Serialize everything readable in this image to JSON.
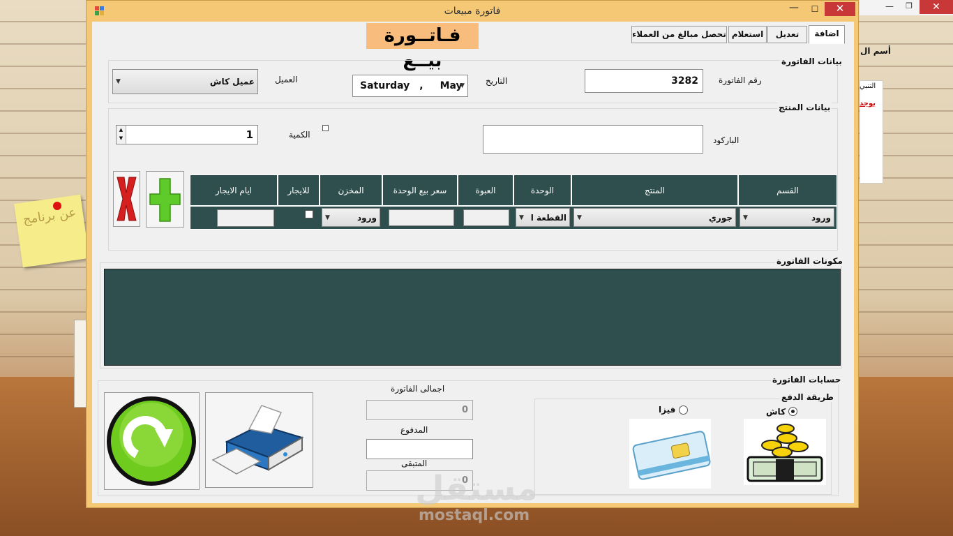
{
  "window": {
    "title": "فاتورة مبيعات",
    "minimize": "—",
    "maximize": "☐",
    "close": "✕"
  },
  "background": {
    "label": "أسم ال",
    "tanbih": "التنبي",
    "yujad": "يوجد",
    "sticky_note": "عن برنامج",
    "btn_min": "—",
    "btn_max": "❐",
    "btn_close": "✕"
  },
  "banner": "فـاتــورة بيــع",
  "tabs": [
    {
      "label": "اضافة",
      "active": true
    },
    {
      "label": "تعديل",
      "active": false
    },
    {
      "label": "استعلام",
      "active": false
    },
    {
      "label": "تحصل مبالغ من العملاء",
      "active": false
    }
  ],
  "invoice_info": {
    "group_title": "بيانات الفاتورة",
    "invoice_number_label": "رقم الفاتورة",
    "invoice_number_value": "3282",
    "date_label": "التاريخ",
    "date_day": "Saturday",
    "date_sep": ",",
    "date_month": "May",
    "customer_label": "العميل",
    "customer_value": "عميل كاش"
  },
  "product_info": {
    "group_title": "بيانات المنتج",
    "barcode_label": "الباركود",
    "barcode_value": "",
    "quantity_label": "الكمية",
    "quantity_value": "1",
    "grid_headers": [
      "القسم",
      "المنتج",
      "الوحدة",
      "العبوة",
      "سعر بيع  الوحدة",
      "المخزن",
      "للايجار",
      "ايام الايجار"
    ],
    "row": {
      "category": "ورود",
      "product": "جوري",
      "unit": "القطعة ا",
      "package": "",
      "unit_price": "",
      "store": "ورود",
      "rent_days": ""
    }
  },
  "invoice_items": {
    "group_title": "مكونات الفاتورة"
  },
  "accounts": {
    "group_title": "حسابات الفاتورة",
    "payment_group_title": "طريقة الدفع",
    "cash_label": "كاش",
    "visa_label": "فيزا",
    "total_label": "اجمالى الفاتورة",
    "total_value": "0",
    "paid_label": "المدفوع",
    "paid_value": "",
    "remaining_label": "المتبقى",
    "remaining_value": "0"
  },
  "watermark": {
    "brand": "مستقل",
    "url": "mostaql.com"
  },
  "colors": {
    "grid_bg": "#2f4f4f",
    "window_frame": "#f5c876",
    "banner_bg": "#f8bd7c",
    "close_red": "#c83838"
  }
}
